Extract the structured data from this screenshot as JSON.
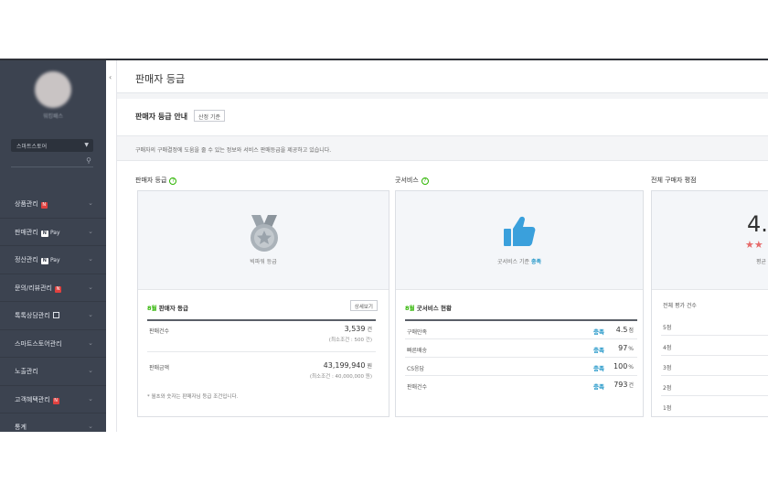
{
  "sidebar": {
    "shop_name": "워킹패스",
    "store_select": "스마트스토어",
    "menu": [
      {
        "label": "상품관리",
        "badge": "n"
      },
      {
        "label": "판매관리",
        "badge": "pay",
        "badge_text": "Pay"
      },
      {
        "label": "정산관리",
        "badge": "pay",
        "badge_text": "Pay"
      },
      {
        "label": "문의/리뷰관리",
        "badge": "n"
      },
      {
        "label": "톡톡상담관리",
        "badge": "doc"
      },
      {
        "label": "스마트스토어관리",
        "badge": ""
      },
      {
        "label": "노출관리",
        "badge": ""
      },
      {
        "label": "고객혜택관리",
        "badge": "n"
      },
      {
        "label": "통계",
        "badge": ""
      }
    ],
    "collapse_icon": "chevron-left-icon"
  },
  "header": {
    "title": "판매자 등급"
  },
  "guide": {
    "title": "판매자 등급 안내",
    "button": "산정 기준",
    "info": "구매자의 구매결정에 도움을 줄 수 있는 정보와 서비스 판매등급을 제공하고 있습니다."
  },
  "grade": {
    "section_title": "판매자 등급",
    "caption": "빅파워 등급",
    "table_month": "8월",
    "table_title": "판매자 등급",
    "detail_button": "상세보기",
    "rows": [
      {
        "label": "판매건수",
        "value": "3,539",
        "unit": "건",
        "sub": "(최소조건 : 500 건)"
      },
      {
        "label": "판매금액",
        "value": "43,199,940",
        "unit": "원",
        "sub": "(최소조건 : 40,000,000 원)"
      }
    ],
    "note": "* 월초와 숫자는 판매자님 등급 조건입니다."
  },
  "goodservice": {
    "section_title": "굿서비스",
    "caption_prefix": "굿서비스 기준",
    "caption_status": "충족",
    "table_month": "8월",
    "table_title": "굿서비스 현황",
    "rows": [
      {
        "label": "구매만족",
        "status": "충족",
        "value": "4.5",
        "unit": "점"
      },
      {
        "label": "빠른배송",
        "status": "충족",
        "value": "97",
        "unit": "%"
      },
      {
        "label": "CS응답",
        "status": "충족",
        "value": "100",
        "unit": "%"
      },
      {
        "label": "판매건수",
        "status": "충족",
        "value": "793",
        "unit": "건"
      }
    ]
  },
  "rating": {
    "section_title": "전체 구매자 평점",
    "score": "4.",
    "stars": "★★",
    "avg_label": "평균",
    "head": "전체 평가 건수",
    "rows": [
      "5점",
      "4점",
      "3점",
      "2점",
      "1점"
    ]
  },
  "colors": {
    "sidebar_bg": "#3c4350",
    "accent_green": "#2db400",
    "accent_blue": "#2196c8",
    "badge_red": "#e0413f",
    "thumb_blue": "#3aa0dc"
  }
}
